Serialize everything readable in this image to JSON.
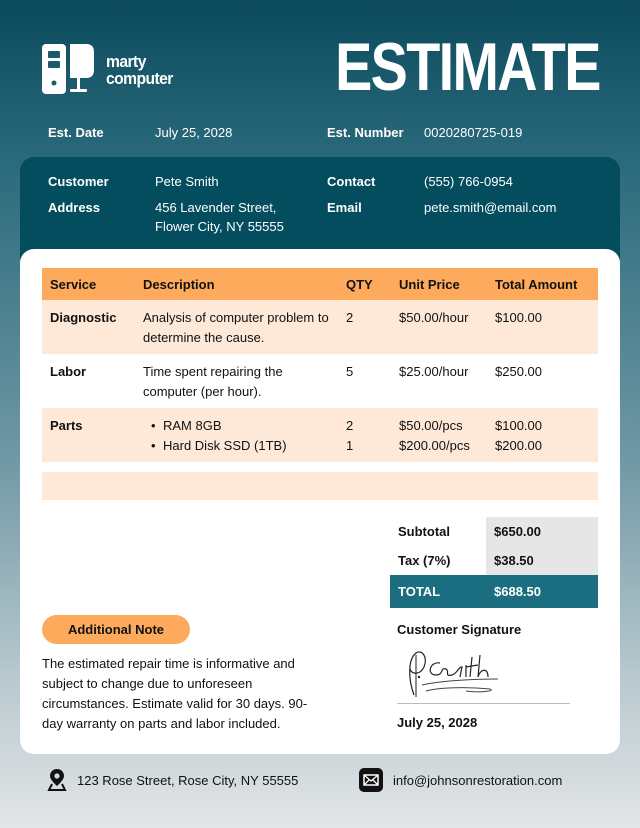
{
  "brand": {
    "name_line1": "marty",
    "name_line2": "computer",
    "logo_icon": "computer-icon"
  },
  "header": {
    "title": "ESTIMATE"
  },
  "meta": {
    "date_label": "Est. Date",
    "date_value": "July 25, 2028",
    "number_label": "Est. Number",
    "number_value": "0020280725-019"
  },
  "customer": {
    "customer_label": "Customer",
    "customer_value": "Pete Smith",
    "address_label": "Address",
    "address_line1": "456 Lavender Street,",
    "address_line2": "Flower City, NY 55555",
    "contact_label": "Contact",
    "contact_value": "(555) 766-0954",
    "email_label": "Email",
    "email_value": "pete.smith@email.com"
  },
  "table": {
    "headers": [
      "Service",
      "Description",
      "QTY",
      "Unit Price",
      "Total Amount"
    ],
    "rows": [
      {
        "service": "Diagnostic",
        "description": "Analysis of computer problem to determine the cause.",
        "qty": "2",
        "unit_price": "$50.00/hour",
        "total": "$100.00"
      },
      {
        "service": "Labor",
        "description": "Time spent repairing the computer (per hour).",
        "qty": "5",
        "unit_price": "$25.00/hour",
        "total": "$250.00"
      }
    ],
    "parts": {
      "service": "Parts",
      "items": [
        {
          "description": "RAM 8GB",
          "qty": "2",
          "unit_price": "$50.00/pcs",
          "total": "$100.00"
        },
        {
          "description": "Hard Disk SSD (1TB)",
          "qty": "1",
          "unit_price": "$200.00/pcs",
          "total": "$200.00"
        }
      ]
    }
  },
  "totals": {
    "subtotal_label": "Subtotal",
    "subtotal_value": "$650.00",
    "tax_label": "Tax (7%)",
    "tax_value": "$38.50",
    "total_label": "TOTAL",
    "total_value": "$688.50"
  },
  "note": {
    "label": "Additional Note",
    "text": "The estimated repair time is informative and subject to change due to unforeseen circumstances. Estimate valid for 30 days. 90-day warranty on parts and labor included."
  },
  "signature": {
    "label": "Customer Signature",
    "date": "July 25, 2028"
  },
  "footer": {
    "address": "123 Rose Street, Rose City, NY 55555",
    "address_icon": "location-pin-icon",
    "email": "info@johnsonrestoration.com",
    "email_icon": "envelope-icon"
  },
  "colors": {
    "dark_teal": "#034d5f",
    "teal": "#1a6e80",
    "orange": "#fdaa5d",
    "peach": "#fee9d8",
    "gray": "#e6e6e6"
  }
}
